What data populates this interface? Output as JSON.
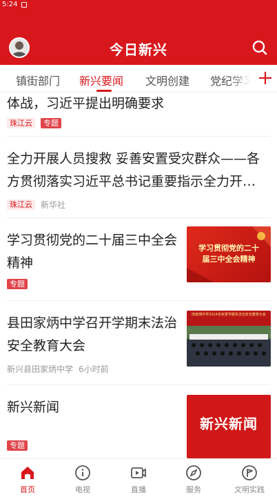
{
  "status_bar": {
    "time": "5:24"
  },
  "header": {
    "title": "今日新兴"
  },
  "tabs": [
    {
      "label": "镇街部门",
      "active": false
    },
    {
      "label": "新兴要闻",
      "active": true
    },
    {
      "label": "文明创建",
      "active": false
    },
    {
      "label": "党纪学习",
      "active": false
    }
  ],
  "feed": [
    {
      "title": "体战，习近平提出明确要求",
      "source": "珠江云",
      "tag": "专题"
    },
    {
      "title": "全力开展人员搜救 妥善安置受灾群众——各方贯彻落实习近平总书记重要指示全力开…",
      "source": "珠江云",
      "publisher": "新华社"
    },
    {
      "title": "学习贯彻党的二十届三中全会精神",
      "tag": "专题",
      "thumb_text": [
        "学习贯彻党的二十",
        "届三中全会精神"
      ]
    },
    {
      "title": "县田家炳中学召开学期末法治安全教育大会",
      "publisher": "新兴县田家炳中学",
      "time": "6小时前",
      "thumb_banner": "田家炳中学2024年秋季学期末法治安全教育大会"
    },
    {
      "title": "新兴新闻",
      "tag": "专题",
      "thumb_text": "新兴新闻"
    }
  ],
  "bottom_nav": [
    {
      "label": "首页",
      "icon": "home-icon",
      "active": true
    },
    {
      "label": "电视",
      "icon": "info-circle-icon",
      "active": false
    },
    {
      "label": "直播",
      "icon": "live-video-icon",
      "active": false
    },
    {
      "label": "服务",
      "icon": "compass-icon",
      "active": false
    },
    {
      "label": "文明实践",
      "icon": "flag-circle-icon",
      "active": false
    }
  ],
  "colors": {
    "brand": "#d8171c"
  }
}
